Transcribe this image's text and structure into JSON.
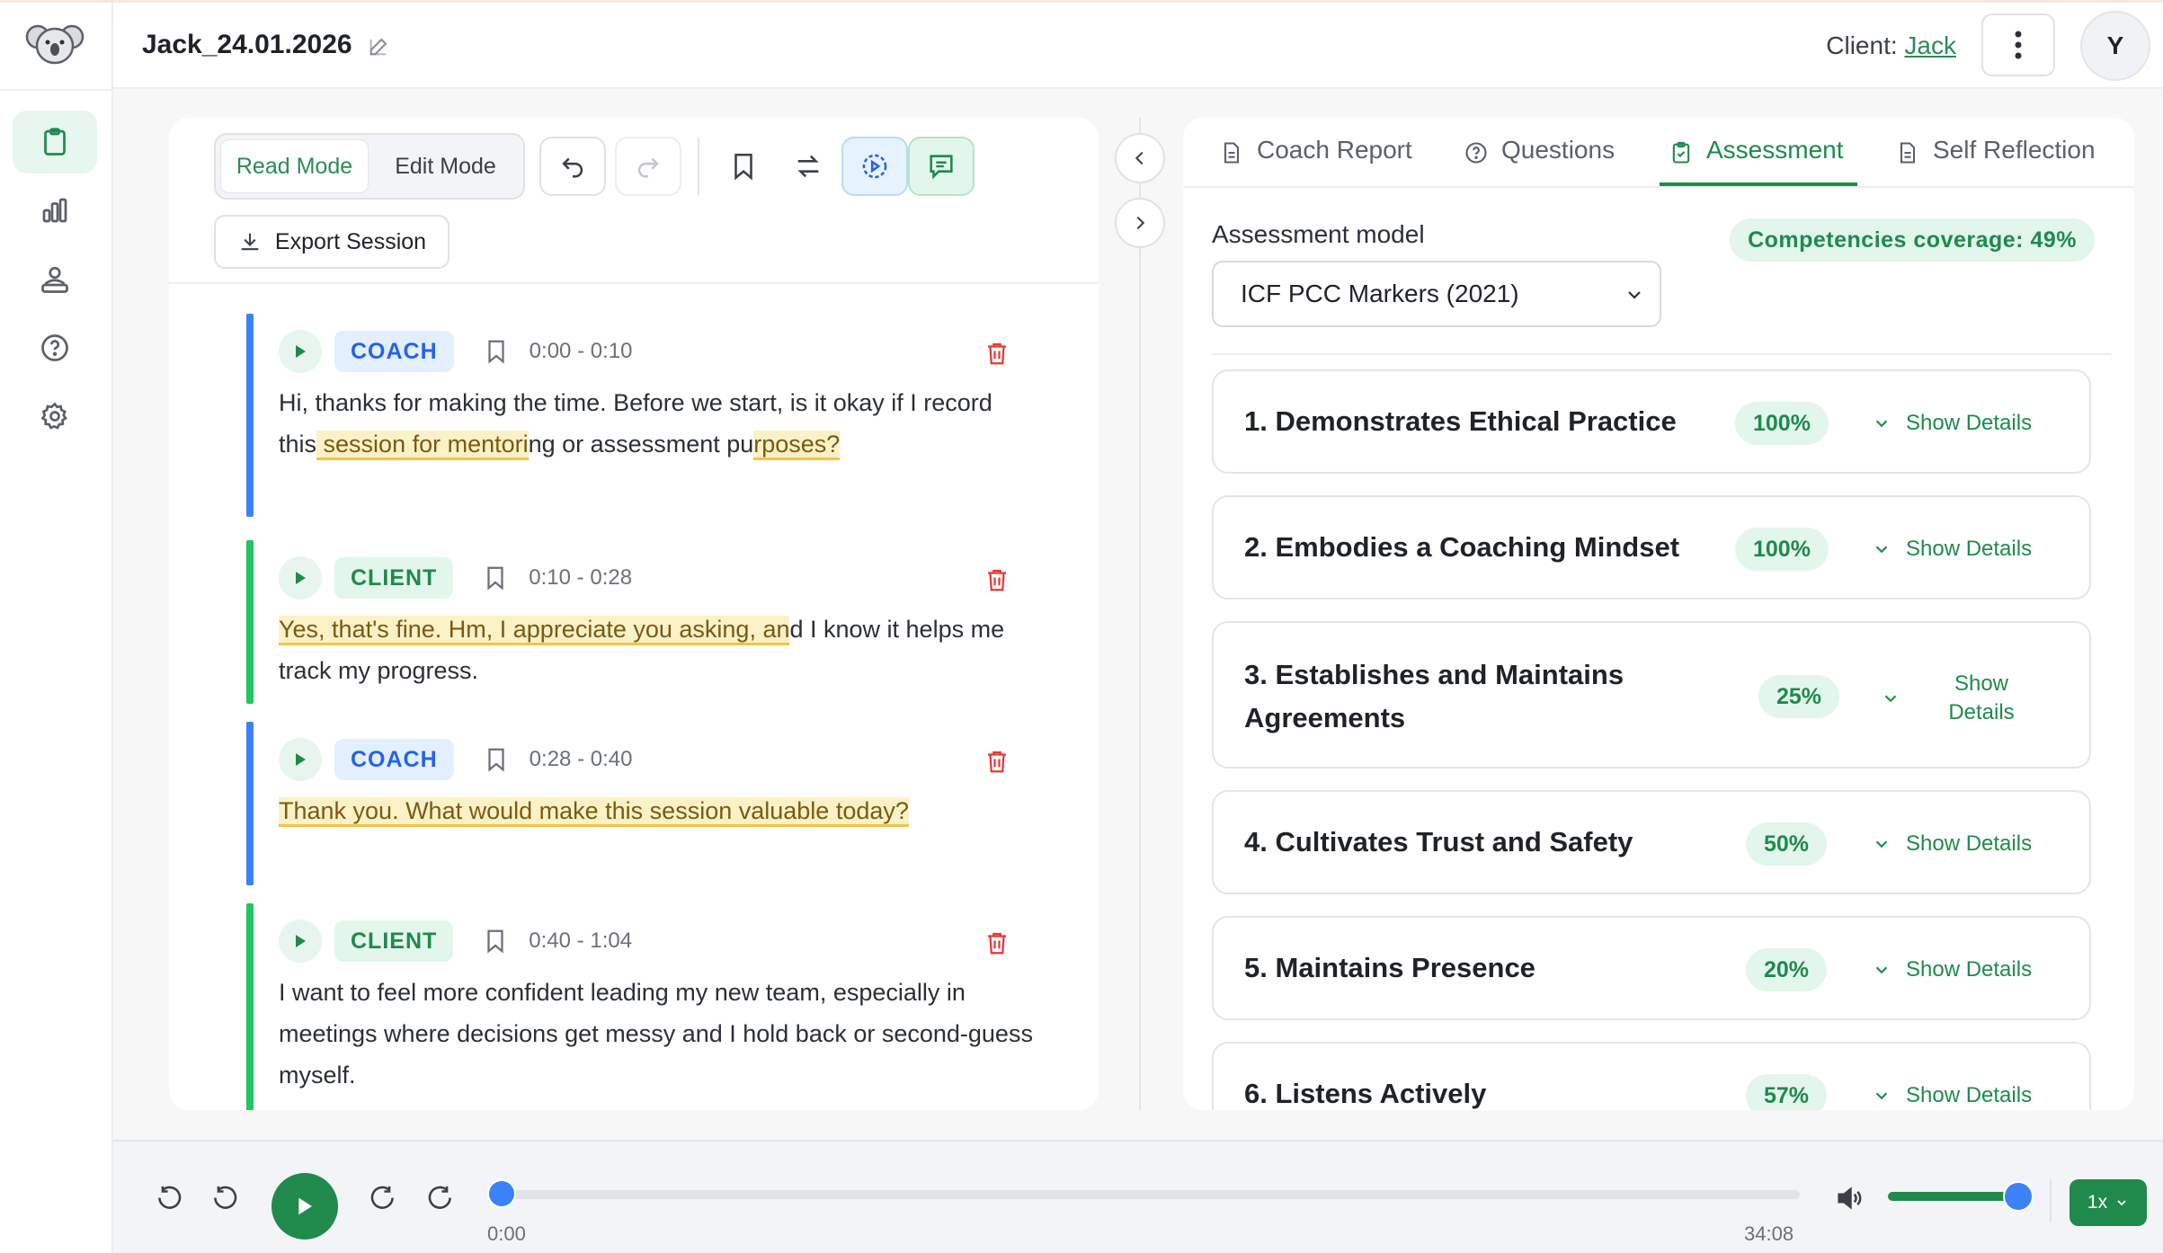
{
  "header": {
    "session_title": "Jack_24.01.2026",
    "client_label": "Client:",
    "client_name": "Jack",
    "avatar_initial": "Y"
  },
  "sidebar": {
    "items": [
      {
        "name": "transcript",
        "icon": "clipboard-icon",
        "active": true
      },
      {
        "name": "analytics",
        "icon": "bar-chart-icon",
        "active": false
      },
      {
        "name": "clients",
        "icon": "users-icon",
        "active": false
      },
      {
        "name": "help",
        "icon": "help-circle-icon",
        "active": false
      },
      {
        "name": "settings",
        "icon": "gear-icon",
        "active": false
      }
    ]
  },
  "toolbar": {
    "read_mode": "Read Mode",
    "edit_mode": "Edit Mode",
    "export_label": "Export Session"
  },
  "transcript": {
    "segments": [
      {
        "role": "COACH",
        "time_start": "0:00",
        "time_end": "0:10",
        "text_before": "Hi, thanks for making the time. Before we start, is it okay if I record this",
        "hl1": " session for mentori",
        "text_mid": "ng or assessment pu",
        "hl2": "rposes?",
        "text_after": ""
      },
      {
        "role": "CLIENT",
        "time_start": "0:10",
        "time_end": "0:28",
        "hl1": "Yes, that's fine. Hm, I appreciate you asking, an",
        "text_after": "d I know it helps me track my progress."
      },
      {
        "role": "COACH",
        "time_start": "0:28",
        "time_end": "0:40",
        "hl1": "Thank you. What would make this session valuable today?"
      },
      {
        "role": "CLIENT",
        "time_start": "0:40",
        "time_end": "1:04",
        "text": "I want to feel more confident leading my new team, especially in meetings where decisions get messy and I hold back or second-guess myself."
      }
    ],
    "time_separator": "-"
  },
  "right_panel": {
    "tabs": [
      {
        "label": "Coach Report",
        "icon": "document-icon"
      },
      {
        "label": "Questions",
        "icon": "help-circle-icon"
      },
      {
        "label": "Assessment",
        "icon": "clipboard-check-icon",
        "active": true
      },
      {
        "label": "Self Reflection",
        "icon": "document-icon"
      }
    ],
    "model_label": "Assessment model",
    "coverage": "Competencies coverage: 49%",
    "model_value": "ICF PCC Markers (2021)",
    "competencies": [
      {
        "title": "1. Demonstrates Ethical Practice",
        "pct": "100%",
        "details": "Show Details"
      },
      {
        "title": "2. Embodies a Coaching Mindset",
        "pct": "100%",
        "details": "Show Details"
      },
      {
        "title": "3. Establishes and Maintains Agreements",
        "pct": "25%",
        "details": "Show Details"
      },
      {
        "title": "4. Cultivates Trust and Safety",
        "pct": "50%",
        "details": "Show Details"
      },
      {
        "title": "5. Maintains Presence",
        "pct": "20%",
        "details": "Show Details"
      },
      {
        "title": "6. Listens Actively",
        "pct": "57%",
        "details": "Show Details"
      }
    ]
  },
  "player": {
    "current_time": "0:00",
    "duration": "34:08",
    "progress_fraction": 0.0,
    "volume_fraction": 0.95,
    "speed": "1x"
  },
  "colors": {
    "accent_green": "#1f8a4c",
    "coach_blue": "#3b82f6",
    "client_green": "#22c55e",
    "highlight": "#fdf1c8",
    "delete_red": "#e53935"
  }
}
